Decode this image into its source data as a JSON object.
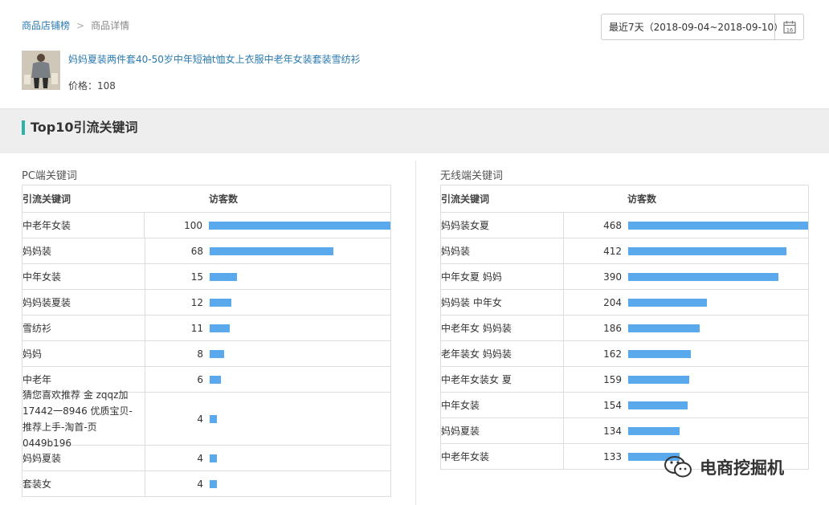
{
  "breadcrumb": {
    "parent": "商品店铺榜",
    "current": "商品详情",
    "separator": ">"
  },
  "date_range": {
    "label": "最近7天（2018-09-04~2018-09-10）",
    "calendar_day": "16"
  },
  "product": {
    "title": "妈妈夏装两件套40-50岁中年短袖t恤女上衣服中老年女装套装雪纺衫",
    "price": "价格：108"
  },
  "section_title": "Top10引流关键词",
  "pc": {
    "label": "PC端关键词",
    "headers": {
      "keyword": "引流关键词",
      "visitors": "访客数"
    },
    "max": 100,
    "rows": [
      {
        "kw": "中老年女装",
        "v": "100",
        "n": 100
      },
      {
        "kw": "妈妈装",
        "v": "68",
        "n": 68
      },
      {
        "kw": "中年女装",
        "v": "15",
        "n": 15
      },
      {
        "kw": "妈妈装夏装",
        "v": "12",
        "n": 12
      },
      {
        "kw": "雪纺衫",
        "v": "11",
        "n": 11
      },
      {
        "kw": "妈妈",
        "v": "8",
        "n": 8
      },
      {
        "kw": "中老年",
        "v": "6",
        "n": 6
      },
      {
        "kw": "猜您喜欢推荐 金 zqqz加17442一8946 优质宝贝-推荐上手-淘首-页0449b196",
        "v": "4",
        "n": 4
      },
      {
        "kw": "妈妈夏装",
        "v": "4",
        "n": 4
      },
      {
        "kw": "套装女",
        "v": "4",
        "n": 4
      }
    ]
  },
  "mobile": {
    "label": "无线端关键词",
    "headers": {
      "keyword": "引流关键词",
      "visitors": "访客数"
    },
    "max": 468,
    "rows": [
      {
        "kw": "妈妈装女夏",
        "v": "468",
        "n": 468
      },
      {
        "kw": "妈妈装",
        "v": "412",
        "n": 412
      },
      {
        "kw": "中年女夏 妈妈",
        "v": "390",
        "n": 390
      },
      {
        "kw": "妈妈装 中年女",
        "v": "204",
        "n": 204
      },
      {
        "kw": "中老年女 妈妈装",
        "v": "186",
        "n": 186
      },
      {
        "kw": "老年装女 妈妈装",
        "v": "162",
        "n": 162
      },
      {
        "kw": "中老年女装女 夏",
        "v": "159",
        "n": 159
      },
      {
        "kw": "中年女装",
        "v": "154",
        "n": 154
      },
      {
        "kw": "妈妈夏装",
        "v": "134",
        "n": 134
      },
      {
        "kw": "中老年女装",
        "v": "133",
        "n": 133
      }
    ]
  },
  "watermark": "电商挖掘机"
}
